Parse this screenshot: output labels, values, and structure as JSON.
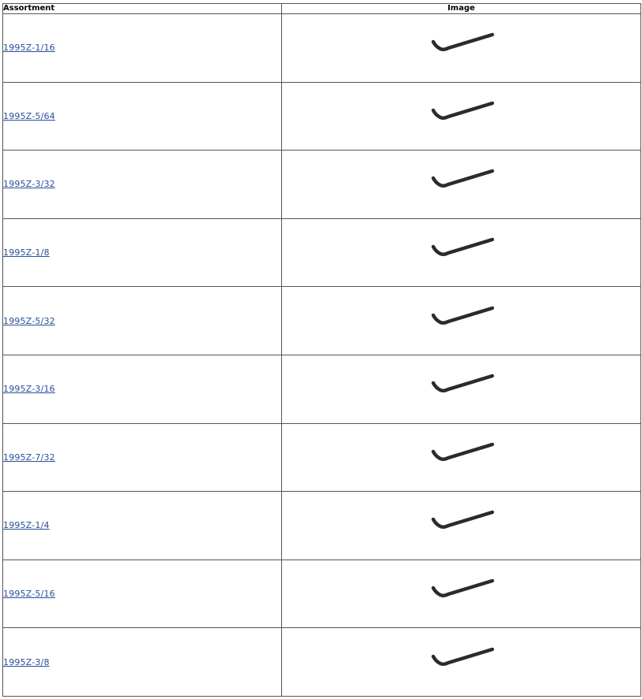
{
  "table": {
    "headers": {
      "assortment": "Assortment",
      "image": "Image"
    },
    "rows": [
      {
        "part": "1995Z-1/16",
        "image_icon": "hex-key-icon"
      },
      {
        "part": "1995Z-5/64",
        "image_icon": "hex-key-icon"
      },
      {
        "part": "1995Z-3/32",
        "image_icon": "hex-key-icon"
      },
      {
        "part": "1995Z-1/8",
        "image_icon": "hex-key-icon"
      },
      {
        "part": "1995Z-5/32",
        "image_icon": "hex-key-icon"
      },
      {
        "part": "1995Z-3/16",
        "image_icon": "hex-key-icon"
      },
      {
        "part": "1995Z-7/32",
        "image_icon": "hex-key-icon"
      },
      {
        "part": "1995Z-1/4",
        "image_icon": "hex-key-icon"
      },
      {
        "part": "1995Z-5/16",
        "image_icon": "hex-key-icon"
      },
      {
        "part": "1995Z-3/8",
        "image_icon": "hex-key-icon"
      }
    ]
  },
  "colors": {
    "link": "#2a4f9a",
    "border": "#555555",
    "icon": "#2b2b2b"
  }
}
